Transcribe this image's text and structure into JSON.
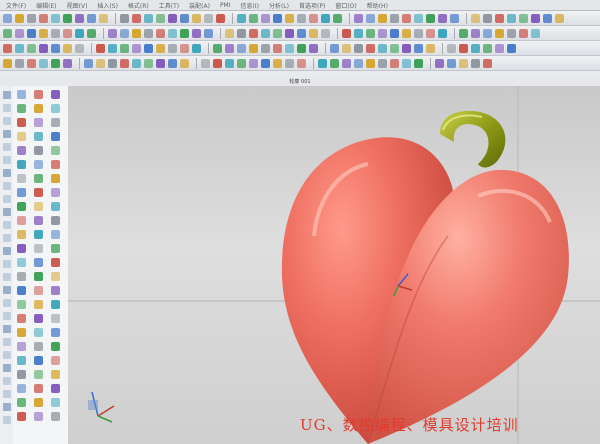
{
  "menu": {
    "items": [
      "文件(F)",
      "编辑(E)",
      "视图(V)",
      "插入(S)",
      "格式(R)",
      "工具(T)",
      "装配(A)",
      "PMI",
      "信息(I)",
      "分析(L)",
      "首选项(P)",
      "窗口(O)",
      "帮助(H)"
    ]
  },
  "viewport": {
    "title": "轮廓 001"
  },
  "model": {
    "name": "heart-pendant",
    "body_color": "#e8685c",
    "ring_color": "#8f9a18"
  },
  "palette_colors": [
    "#3a73c6",
    "#2f9b4a",
    "#c94b3f",
    "#d4a020",
    "#7a4fb8",
    "#2ea0b8",
    "#888f99"
  ],
  "watermark": {
    "text": "UG、数控编程、模具设计培训"
  }
}
